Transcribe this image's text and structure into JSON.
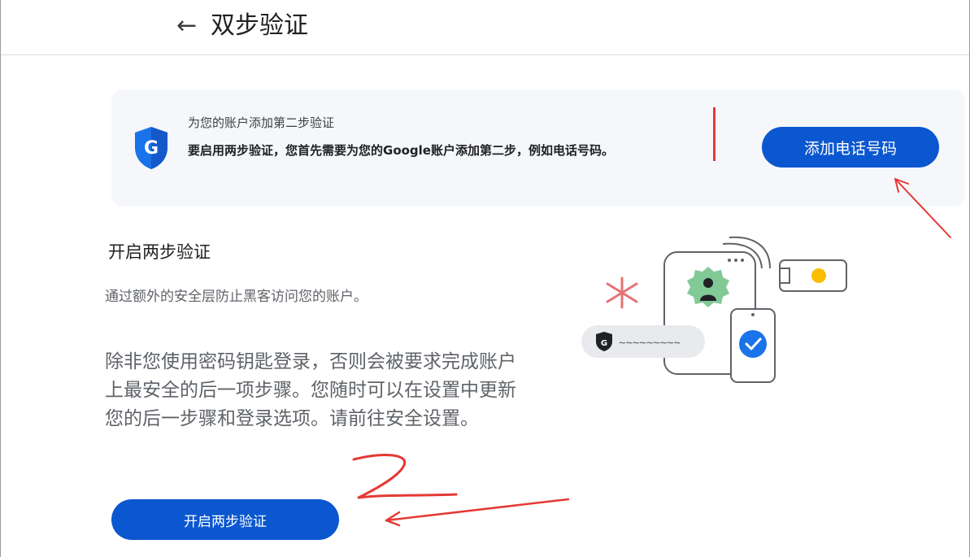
{
  "header": {
    "back_arrow": "←",
    "title": "双步验证"
  },
  "banner": {
    "title": "为您的账户添加第二步验证",
    "description": "要启用两步验证，您首先需要为您的Google账户添加第二步，例如电话号码。",
    "shield_letter": "G",
    "button_label": "添加电话号码"
  },
  "main": {
    "title": "开启两步验证",
    "subtitle": "通过额外的安全层防止黑客访问您的账户。",
    "notice": "除非您使用密码钥匙登录，否则会被要求完成账户上最安全的后一项步骤。您随时可以在设置中更新您的后一步骤和登录选项。请前往安全设置。",
    "button_label": "开启两步验证"
  },
  "illustration": {
    "chip_letter": "G",
    "chip_text": "~~~~~~~~~"
  },
  "colors": {
    "primary_blue": "#0b57d0",
    "annotation_red": "#e53935",
    "banner_bg": "#f5f7fb"
  }
}
